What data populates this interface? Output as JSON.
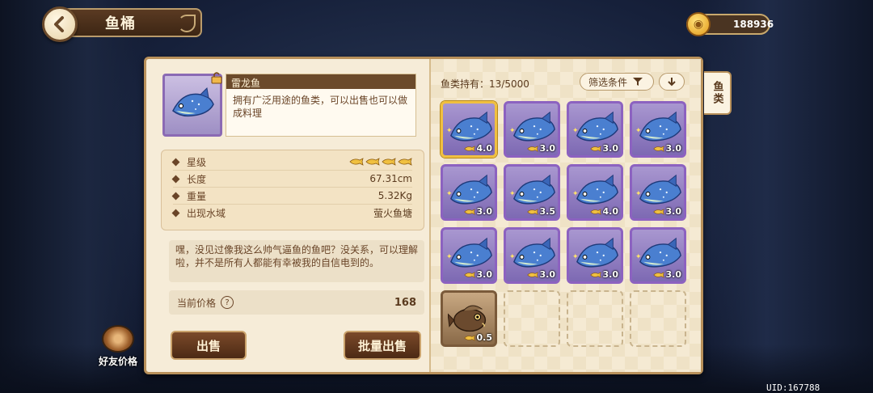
{
  "header": {
    "title": "鱼桶",
    "coins": "188936"
  },
  "side_tab": {
    "label": "鱼类"
  },
  "selected_fish": {
    "name": "雷龙鱼",
    "description": "拥有广泛用途的鱼类，可以出售也可以做成料理",
    "stats": [
      {
        "label": "星级",
        "value": "",
        "stars": 4
      },
      {
        "label": "长度",
        "value": "67.31cm"
      },
      {
        "label": "重量",
        "value": "5.32Kg"
      },
      {
        "label": "出现水域",
        "value": "萤火鱼塘"
      }
    ],
    "quote": "嘿，没见过像我这么帅气逼鱼的鱼吧？没关系，可以理解啦，并不是所有人都能有幸被我的自信电到的。",
    "price_label": "当前价格",
    "price_help": "?",
    "price": "168"
  },
  "buttons": {
    "sell": "出售",
    "batch_sell": "批量出售",
    "friend_price": "好友价格"
  },
  "inventory": {
    "holdings": "鱼类持有：13/5000",
    "filter_label": "筛选条件",
    "slots": [
      {
        "rating": "4.0",
        "type": "thunder",
        "selected": true
      },
      {
        "rating": "3.0",
        "type": "thunder"
      },
      {
        "rating": "3.0",
        "type": "thunder"
      },
      {
        "rating": "3.0",
        "type": "thunder"
      },
      {
        "rating": "3.0",
        "type": "thunder"
      },
      {
        "rating": "3.5",
        "type": "thunder"
      },
      {
        "rating": "4.0",
        "type": "thunder"
      },
      {
        "rating": "3.0",
        "type": "thunder"
      },
      {
        "rating": "3.0",
        "type": "thunder"
      },
      {
        "rating": "3.0",
        "type": "thunder"
      },
      {
        "rating": "3.0",
        "type": "thunder"
      },
      {
        "rating": "3.0",
        "type": "thunder"
      },
      {
        "rating": "0.5",
        "type": "brown"
      },
      {
        "rating": "",
        "type": "empty"
      },
      {
        "rating": "",
        "type": "empty"
      },
      {
        "rating": "",
        "type": "empty"
      }
    ]
  },
  "uid": "UID:167788",
  "colors": {
    "panel": "#f6ecd8",
    "frame": "#b8905a",
    "rare_slot": "#8c62c0",
    "selected_slot": "#f0c040"
  }
}
